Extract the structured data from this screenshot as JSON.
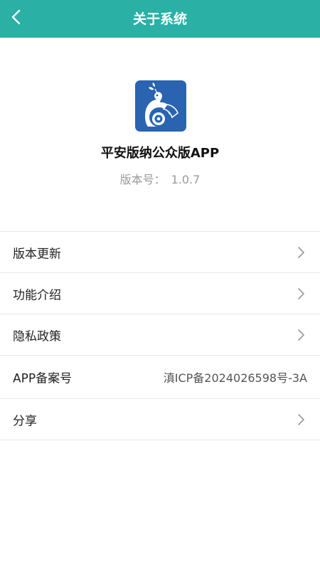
{
  "header": {
    "title": "关于系统",
    "back_icon": "chevron-left-icon",
    "background_color": "#2bb0a6"
  },
  "app": {
    "name": "平安版纳公众版APP",
    "version_label": "版本号：",
    "version": "1.0.7",
    "logo_icon": "peacock-logo",
    "logo_color": "#2a64b0"
  },
  "menu": {
    "items": [
      {
        "label": "版本更新",
        "icon": "chevron-right-icon"
      },
      {
        "label": "功能介绍",
        "icon": "chevron-right-icon"
      },
      {
        "label": "隐私政策",
        "icon": "chevron-right-icon"
      },
      {
        "label": "APP备案号",
        "value": "滇ICP备2024026598号-3A"
      },
      {
        "label": "分享",
        "icon": "chevron-right-icon"
      }
    ]
  }
}
